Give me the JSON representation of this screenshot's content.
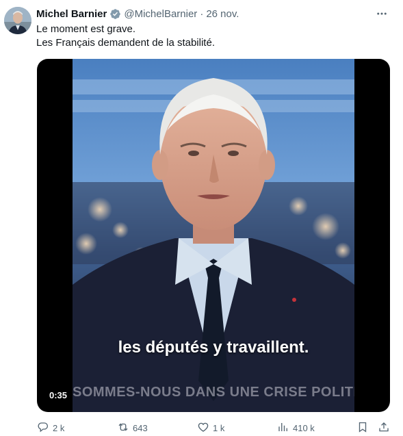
{
  "author": {
    "name": "Michel Barnier",
    "handle": "@MichelBarnier",
    "separator": "·",
    "date": "26 nov."
  },
  "tweet": {
    "line1": "Le moment est grave.",
    "line2": "Les Français demandent de la stabilité."
  },
  "video": {
    "duration": "0:35",
    "caption": "les députés y travaillent.",
    "banner": "SOMMES-NOUS DANS UNE CRISE POLITIQUE"
  },
  "actions": {
    "replies": "2 k",
    "reposts": "643",
    "likes": "1 k",
    "views": "410 k"
  },
  "icons": {
    "verified": "verified-badge-icon",
    "more": "more-icon",
    "reply": "reply-icon",
    "repost": "repost-icon",
    "like": "like-icon",
    "views": "views-icon",
    "bookmark": "bookmark-icon",
    "share": "share-icon"
  },
  "colors": {
    "verified": "#829aab",
    "secondary_text": "#536471",
    "primary_text": "#0f1419"
  }
}
